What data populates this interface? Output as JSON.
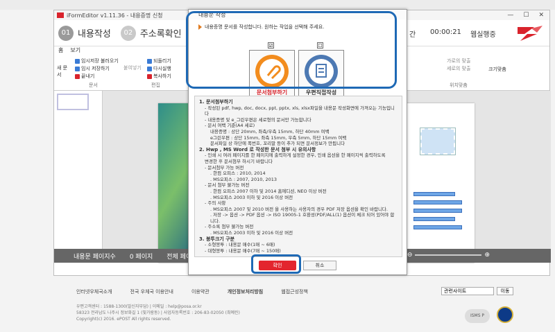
{
  "app": {
    "title": "iFormEditor v1.11.36 - 내용증명 신청",
    "steps": [
      {
        "num": "01",
        "label": "내용작성"
      },
      {
        "num": "02",
        "label": "주소록확인"
      },
      {
        "num": "03",
        "label": "미"
      }
    ],
    "step4_label": "간",
    "timer": "00:00:21",
    "status_label": "웹실행중"
  },
  "ribbon": {
    "tabs": [
      "홈",
      "보기"
    ],
    "items": [
      "임시저장 불러오기",
      "임시 저장하기",
      "끝내기",
      "되돌리기",
      "다시실행",
      "복사하기",
      "붙여넣기"
    ],
    "new_doc": "새 문서",
    "groups": [
      "문서",
      "편집",
      "위치맞춤"
    ],
    "right_items": [
      "가로의 맞출",
      "세로의 맞출",
      "크기맞춤"
    ]
  },
  "statusbar": {
    "pages_label": "내용문 페이지수",
    "pages_value": "0 페이지",
    "total_label": "전체 페이지",
    "zoom": "0%"
  },
  "dialog": {
    "title": "내용문 작성",
    "message": "내용증명 문서를 작성합니다. 원하는 작업을 선택해 주세요.",
    "option1": "문서첨부하기",
    "option2": "우편직접작성",
    "option1_checked": "☑",
    "option2_checked": "☐",
    "ok": "확인",
    "cancel": "취소",
    "lines": [
      {
        "cls": "h",
        "text": "1. 문서첨부하기"
      },
      {
        "cls": "indent",
        "text": "- 작성된 pdf, hwp, doc, docx, ppt, pptx, xls, xlsx파일을 내용문 작성화면에 가져오는 기능입니다"
      },
      {
        "cls": "indent",
        "text": "- 내용증명 및 e_그린우편은 세로형의 문서만 가능합니다"
      },
      {
        "cls": "indent",
        "text": "- 문서 여백 기준(A4 세로)"
      },
      {
        "cls": "indent2",
        "text": "내용증명 : 상단 20mm, 좌측/우측 15mm, 하단 40mm 여백"
      },
      {
        "cls": "indent2",
        "text": "e그린우편 : 상단 15mm, 좌측 15mm, 우측 5mm, 하단 15mm 여백"
      },
      {
        "cls": "indent2",
        "text": "문서파일 상 하단에 폭번호, 꼬리말 등이 추가 되면 문서정보가 만됩니다"
      },
      {
        "cls": "h",
        "text": "2. Hwp , MS Word 로 작성한 문서 첨부 시 유의사항"
      },
      {
        "cls": "indent",
        "text": "- 인쇄 시 여러 페이지를 한 페이지에 출력하게 설정한 경우, 인쇄 옵션을 한 페이지씩 출력하도록"
      },
      {
        "cls": "indent",
        "text": "변경한 후 문서첨부 하시기 바랍니다"
      },
      {
        "cls": "indent",
        "text": "- 문서첨부 가능 버전"
      },
      {
        "cls": "indent2",
        "text": ". 한컴 오피스 : 2010, 2014"
      },
      {
        "cls": "indent2",
        "text": ". MS오피스 : 2007, 2010, 2013"
      },
      {
        "cls": "indent",
        "text": "- 문서 첨부 불가능 버전"
      },
      {
        "cls": "indent2",
        "text": ". 한컴 오피스 2007 이하 및 2014 홈에디션, NEO 이상 버전"
      },
      {
        "cls": "indent2",
        "text": ". MS오피스 2003 이하 및 2016 이상 버전"
      },
      {
        "cls": "indent",
        "text": "- 주의 사항"
      },
      {
        "cls": "indent2",
        "text": ". MS오피스 2007 및 2010 버전 을 사용하는 사용자의 경우 PDF 저장 옵션을 확인 바랍니다."
      },
      {
        "cls": "indent2",
        "text": ". 저장 -> 옵션 -> PDF 옵션 -> ISO 19005-1 호환성(PDF/ALL(1) 옵션이 체크 되어 있어야 합니다."
      },
      {
        "cls": "indent",
        "text": "- 주소록 첨부 불가능 버전"
      },
      {
        "cls": "indent2",
        "text": ". MS오피스 2003 이하 및 2016 이상 버전"
      },
      {
        "cls": "h",
        "text": "3. 봉투크기 구분"
      },
      {
        "cls": "indent",
        "text": "- 소형봉투 : 내용문 매수(1매 ~ 6매)"
      },
      {
        "cls": "indent",
        "text": "- 대형봉투 : 내용문 매수(7매 ~ 150매)"
      }
    ]
  },
  "footer": {
    "links": [
      "인터넷우체국소개",
      "전국 우체국 이용안내",
      "이용약관",
      "개인정보처리방침",
      "웹접근성정책"
    ],
    "info": [
      "우편고객센터 : 1588-1300(발신자부담)  |  이메일 : help@posa.or.kr",
      "58323 전라남도 나주시 정보화길 1 (빛가람동)  |  사업자등록번호 : 206-83-02050 (최예린)",
      "Copyright(c) 2016. ePOST All rights reserved."
    ],
    "related": "관련사이트",
    "go": "이동",
    "badge": "ISMS P"
  },
  "colors": {
    "accent": "#1e69b5",
    "ok": "#e3252e",
    "brand_red": "#d9232c",
    "option1": "#f28c1e",
    "option2": "#4d79b3"
  }
}
